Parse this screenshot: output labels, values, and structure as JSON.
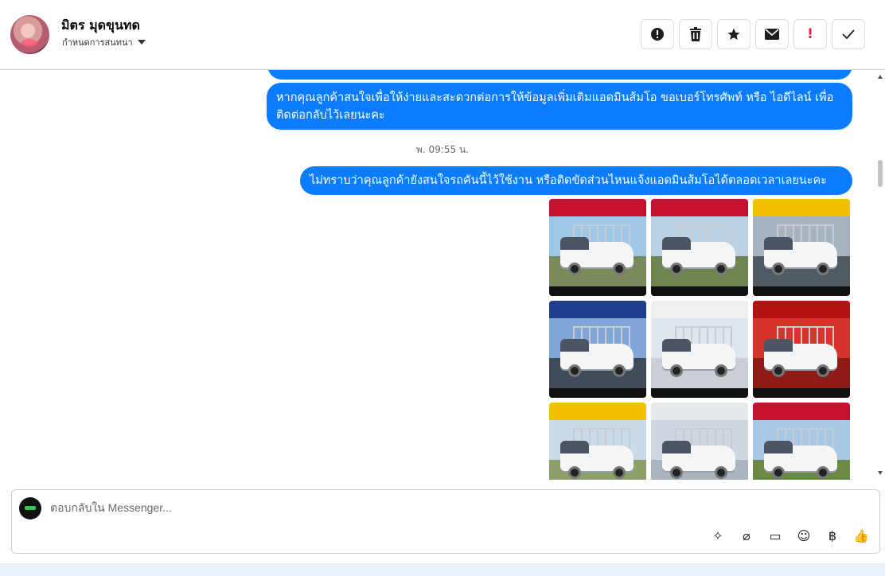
{
  "header": {
    "name": "มิตร มุดขุนทด",
    "subtitle": "กำหนดการสนทนา",
    "toolbar": [
      {
        "id": "alert",
        "icon": "alert-circle-icon",
        "glyph": "●"
      },
      {
        "id": "delete",
        "icon": "trash-icon",
        "glyph": "🗑"
      },
      {
        "id": "star",
        "icon": "star-icon",
        "glyph": "★"
      },
      {
        "id": "mail",
        "icon": "envelope-icon",
        "glyph": "✉"
      },
      {
        "id": "spam",
        "icon": "exclamation-icon",
        "glyph": "!"
      },
      {
        "id": "done",
        "icon": "checkmark-icon",
        "glyph": "✓"
      }
    ]
  },
  "messages": {
    "msg1": "หากคุณลูกค้าสนใจเพื่อให้ง่ายและสะดวกต่อการให้ข้อมูลเพิ่มเติมแอดมินส้มโอ ขอเบอร์โทรศัพท์ หรือ ไอดีไลน์ เพื่อติดต่อกลับไว้เลยนะคะ",
    "timestamp": "พ. 09:55 น.",
    "msg2": "ไม่ทราบว่าคุณลูกค้ายังสนใจรถคันนี้ไว้ใช้งาน หรือติดขัดส่วนไหนแจ้งแอดมินส้มโอได้ตลอดเวลาเลยนะคะ"
  },
  "photos": [
    {
      "band": "#c8102e",
      "sky": "#9ec7e8",
      "ground": "#7a8a5a"
    },
    {
      "band": "#c8102e",
      "sky": "#b9d2e6",
      "ground": "#6f8550"
    },
    {
      "band": "#f2c200",
      "sky": "#a7b4bf",
      "ground": "#505a63"
    },
    {
      "band": "#1f3f8c",
      "sky": "#7fa6d6",
      "ground": "#3f4b5a"
    },
    {
      "band": "#f0f0f0",
      "sky": "#dfe6ec",
      "ground": "#c9cfd5"
    },
    {
      "band": "#b31212",
      "sky": "#d8332a",
      "ground": "#8f1b17"
    },
    {
      "band": "#f2c200",
      "sky": "#c9dbe9",
      "ground": "#8da06a"
    },
    {
      "band": "#e6eaef",
      "sky": "#cfd8e1",
      "ground": "#a9b4bf"
    },
    {
      "band": "#c8102e",
      "sky": "#a8c9e6",
      "ground": "#6b8a45"
    }
  ],
  "composer": {
    "placeholder": "ตอบกลับใน Messenger...",
    "tools": [
      {
        "icon": "sticker-icon",
        "glyph": "✧"
      },
      {
        "icon": "paperclip-icon",
        "glyph": "⌀"
      },
      {
        "icon": "chat-bubble-icon",
        "glyph": "▭"
      },
      {
        "icon": "emoji-icon",
        "glyph": "☺"
      },
      {
        "icon": "baht-icon",
        "glyph": "฿"
      },
      {
        "icon": "thumbs-up-icon",
        "glyph": "👍"
      }
    ]
  }
}
